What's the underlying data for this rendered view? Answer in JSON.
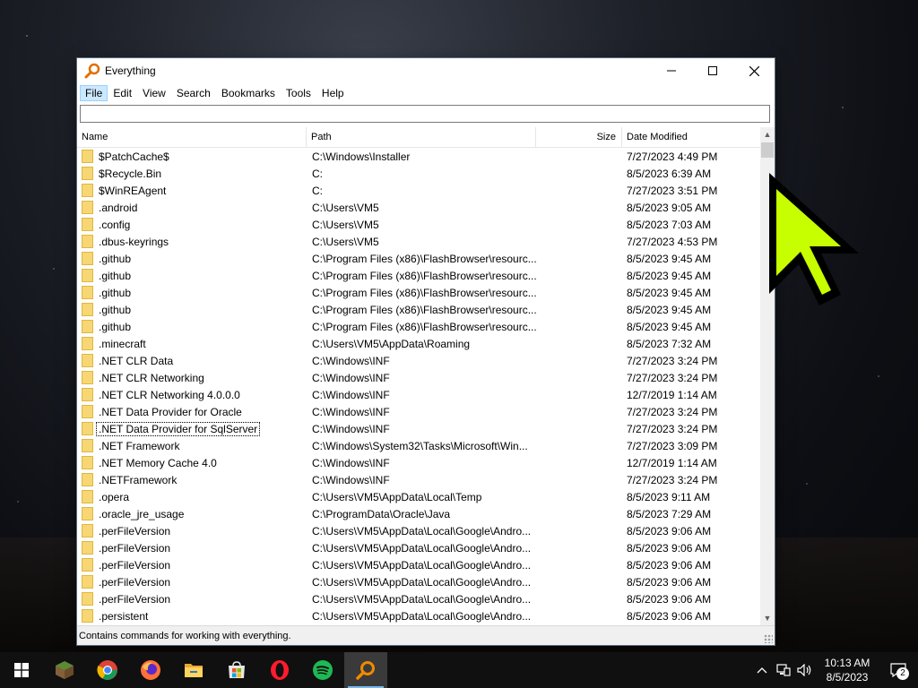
{
  "window": {
    "title": "Everything"
  },
  "menu": [
    {
      "label": "File",
      "active": true
    },
    {
      "label": "Edit"
    },
    {
      "label": "View"
    },
    {
      "label": "Search"
    },
    {
      "label": "Bookmarks"
    },
    {
      "label": "Tools"
    },
    {
      "label": "Help"
    }
  ],
  "search": {
    "value": ""
  },
  "columns": {
    "name": "Name",
    "path": "Path",
    "size": "Size",
    "date": "Date Modified"
  },
  "rows": [
    {
      "name": "$PatchCache$",
      "path": "C:\\Windows\\Installer",
      "size": "",
      "date": "7/27/2023 4:49 PM"
    },
    {
      "name": "$Recycle.Bin",
      "path": "C:",
      "size": "",
      "date": "8/5/2023 6:39 AM"
    },
    {
      "name": "$WinREAgent",
      "path": "C:",
      "size": "",
      "date": "7/27/2023 3:51 PM"
    },
    {
      "name": ".android",
      "path": "C:\\Users\\VM5",
      "size": "",
      "date": "8/5/2023 9:05 AM"
    },
    {
      "name": ".config",
      "path": "C:\\Users\\VM5",
      "size": "",
      "date": "8/5/2023 7:03 AM"
    },
    {
      "name": ".dbus-keyrings",
      "path": "C:\\Users\\VM5",
      "size": "",
      "date": "7/27/2023 4:53 PM"
    },
    {
      "name": ".github",
      "path": "C:\\Program Files (x86)\\FlashBrowser\\resourc...",
      "size": "",
      "date": "8/5/2023 9:45 AM"
    },
    {
      "name": ".github",
      "path": "C:\\Program Files (x86)\\FlashBrowser\\resourc...",
      "size": "",
      "date": "8/5/2023 9:45 AM"
    },
    {
      "name": ".github",
      "path": "C:\\Program Files (x86)\\FlashBrowser\\resourc...",
      "size": "",
      "date": "8/5/2023 9:45 AM"
    },
    {
      "name": ".github",
      "path": "C:\\Program Files (x86)\\FlashBrowser\\resourc...",
      "size": "",
      "date": "8/5/2023 9:45 AM"
    },
    {
      "name": ".github",
      "path": "C:\\Program Files (x86)\\FlashBrowser\\resourc...",
      "size": "",
      "date": "8/5/2023 9:45 AM"
    },
    {
      "name": ".minecraft",
      "path": "C:\\Users\\VM5\\AppData\\Roaming",
      "size": "",
      "date": "8/5/2023 7:32 AM"
    },
    {
      "name": ".NET CLR Data",
      "path": "C:\\Windows\\INF",
      "size": "",
      "date": "7/27/2023 3:24 PM"
    },
    {
      "name": ".NET CLR Networking",
      "path": "C:\\Windows\\INF",
      "size": "",
      "date": "7/27/2023 3:24 PM"
    },
    {
      "name": ".NET CLR Networking 4.0.0.0",
      "path": "C:\\Windows\\INF",
      "size": "",
      "date": "12/7/2019 1:14 AM"
    },
    {
      "name": ".NET Data Provider for Oracle",
      "path": "C:\\Windows\\INF",
      "size": "",
      "date": "7/27/2023 3:24 PM"
    },
    {
      "name": ".NET Data Provider for SqlServer",
      "path": "C:\\Windows\\INF",
      "size": "",
      "date": "7/27/2023 3:24 PM",
      "focused": true
    },
    {
      "name": ".NET Framework",
      "path": "C:\\Windows\\System32\\Tasks\\Microsoft\\Win...",
      "size": "",
      "date": "7/27/2023 3:09 PM"
    },
    {
      "name": ".NET Memory Cache 4.0",
      "path": "C:\\Windows\\INF",
      "size": "",
      "date": "12/7/2019 1:14 AM"
    },
    {
      "name": ".NETFramework",
      "path": "C:\\Windows\\INF",
      "size": "",
      "date": "7/27/2023 3:24 PM"
    },
    {
      "name": ".opera",
      "path": "C:\\Users\\VM5\\AppData\\Local\\Temp",
      "size": "",
      "date": "8/5/2023 9:11 AM"
    },
    {
      "name": ".oracle_jre_usage",
      "path": "C:\\ProgramData\\Oracle\\Java",
      "size": "",
      "date": "8/5/2023 7:29 AM"
    },
    {
      "name": ".perFileVersion",
      "path": "C:\\Users\\VM5\\AppData\\Local\\Google\\Andro...",
      "size": "",
      "date": "8/5/2023 9:06 AM"
    },
    {
      "name": ".perFileVersion",
      "path": "C:\\Users\\VM5\\AppData\\Local\\Google\\Andro...",
      "size": "",
      "date": "8/5/2023 9:06 AM"
    },
    {
      "name": ".perFileVersion",
      "path": "C:\\Users\\VM5\\AppData\\Local\\Google\\Andro...",
      "size": "",
      "date": "8/5/2023 9:06 AM"
    },
    {
      "name": ".perFileVersion",
      "path": "C:\\Users\\VM5\\AppData\\Local\\Google\\Andro...",
      "size": "",
      "date": "8/5/2023 9:06 AM"
    },
    {
      "name": ".perFileVersion",
      "path": "C:\\Users\\VM5\\AppData\\Local\\Google\\Andro...",
      "size": "",
      "date": "8/5/2023 9:06 AM"
    },
    {
      "name": ".persistent",
      "path": "C:\\Users\\VM5\\AppData\\Local\\Google\\Andro...",
      "size": "",
      "date": "8/5/2023 9:06 AM"
    }
  ],
  "status": {
    "text": "Contains commands for working with everything."
  },
  "taskbar": {
    "apps": [
      {
        "name": "minecraft-icon"
      },
      {
        "name": "chrome-icon"
      },
      {
        "name": "firefox-icon"
      },
      {
        "name": "file-explorer-icon"
      },
      {
        "name": "microsoft-store-icon"
      },
      {
        "name": "opera-icon"
      },
      {
        "name": "spotify-icon"
      },
      {
        "name": "everything-icon",
        "active": true
      }
    ],
    "time": "10:13 AM",
    "date": "8/5/2023",
    "notification_count": "2"
  },
  "colors": {
    "accent": "#76b9ed",
    "pointer": "#c8ff00",
    "folder": "#f7d774"
  }
}
